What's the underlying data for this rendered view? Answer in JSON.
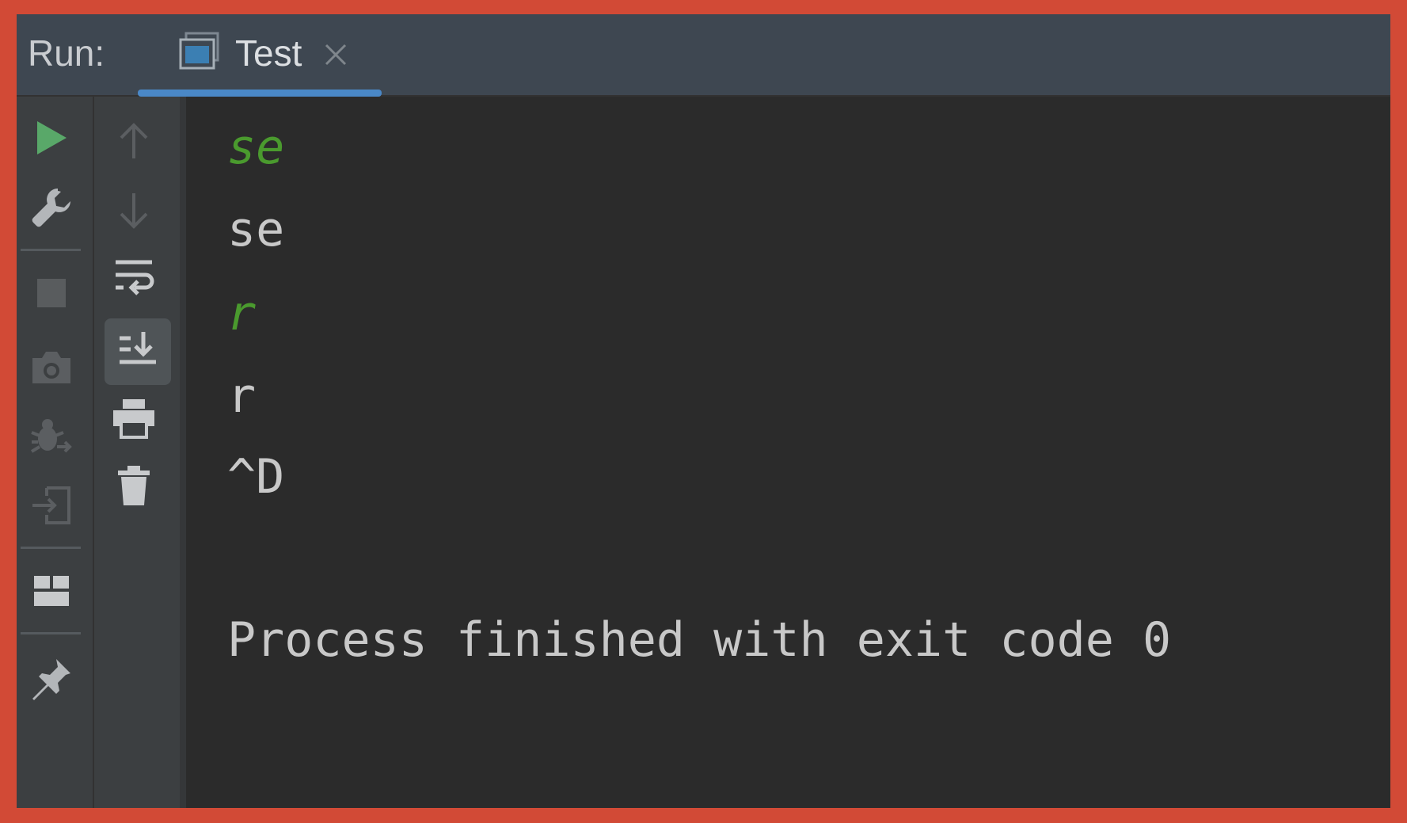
{
  "colors": {
    "frame_border": "#d24a36",
    "titlebar_bg": "#3e4751",
    "toolbar_bg": "#3c3f41",
    "console_bg": "#2b2b2b",
    "tab_underline": "#4a88c7",
    "stdin_text": "#4a9a2e",
    "stdout_text": "#c8c8c8",
    "run_icon": "#59a869"
  },
  "titlebar": {
    "run_label": "Run:",
    "tab": {
      "label": "Test",
      "icon": "console-window-icon",
      "close_icon": "close-icon"
    }
  },
  "left_toolbar": {
    "buttons": [
      {
        "name": "rerun",
        "icon": "play-icon"
      },
      {
        "name": "edit-configuration",
        "icon": "wrench-icon"
      },
      {
        "name": "stop",
        "icon": "stop-icon"
      },
      {
        "name": "dump-threads",
        "icon": "camera-icon"
      },
      {
        "name": "exit-and-debug",
        "icon": "bug-icon"
      },
      {
        "name": "restore-layout",
        "icon": "import-icon"
      },
      {
        "name": "layout",
        "icon": "layout-icon"
      },
      {
        "name": "pin-tab",
        "icon": "pin-icon"
      }
    ]
  },
  "second_toolbar": {
    "buttons": [
      {
        "name": "up-stack-trace",
        "icon": "arrow-up-icon"
      },
      {
        "name": "down-stack-trace",
        "icon": "arrow-down-icon"
      },
      {
        "name": "soft-wrap",
        "icon": "soft-wrap-icon"
      },
      {
        "name": "scroll-to-end",
        "icon": "scroll-to-end-icon"
      },
      {
        "name": "print",
        "icon": "printer-icon"
      },
      {
        "name": "clear-all",
        "icon": "trash-icon"
      }
    ]
  },
  "console": {
    "lines": [
      {
        "text": "se",
        "kind": "stdin"
      },
      {
        "text": "se",
        "kind": "stdout"
      },
      {
        "text": "r",
        "kind": "stdin"
      },
      {
        "text": "r",
        "kind": "stdout"
      },
      {
        "text": "^D",
        "kind": "stdout"
      },
      {
        "text": "Process finished with exit code 0",
        "kind": "stdout"
      }
    ]
  }
}
